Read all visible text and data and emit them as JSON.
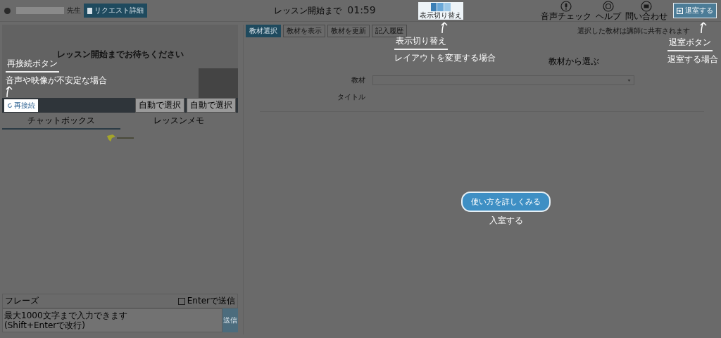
{
  "header": {
    "teacher_suffix": "先生",
    "request_button": "リクエスト詳細",
    "countdown_label": "レッスン開始まで",
    "countdown": "01:59",
    "layout_switch_label": "表示切り替え",
    "tools": [
      {
        "kind": "mic",
        "label": "音声チェック"
      },
      {
        "kind": "help",
        "label": "ヘルプ"
      },
      {
        "kind": "mail",
        "label": "問い合わせ"
      }
    ],
    "exit_button": "退室する"
  },
  "video": {
    "message": "レッスン開始までお待ちください",
    "reconnect_button": "再接続",
    "device_selects": [
      "自動で選択",
      "自動で選択"
    ]
  },
  "chat": {
    "tabs": [
      {
        "label": "チャットボックス",
        "selected": true
      },
      {
        "label": "レッスンメモ",
        "selected": false
      }
    ],
    "phrase_label": "フレーズ",
    "enter_to_send": {
      "label": "Enterで送信",
      "checked": false
    },
    "message_placeholder": "最大1000文字まで入力できます\n(Shift+Enterで改行)",
    "send_button": "送信"
  },
  "materials": {
    "toolbar": [
      {
        "label": "教材選択",
        "selected": true
      },
      {
        "label": "教材を表示",
        "selected": false
      },
      {
        "label": "教材を更新",
        "selected": false
      },
      {
        "label": "記入履歴",
        "selected": false
      }
    ],
    "note": "選択した教材は講師に共有されます",
    "heading": "教材から選ぶ",
    "fields": [
      {
        "kind": "select",
        "label": "教材"
      },
      {
        "kind": "text",
        "label": "タイトル"
      }
    ]
  },
  "tour": {
    "callouts": [
      {
        "kind": "reconnect",
        "title": "再接続ボタン",
        "text": "音声や映像が不安定な場合"
      },
      {
        "kind": "layout",
        "title": "表示切り替え",
        "text": "レイアウトを変更する場合"
      },
      {
        "kind": "exit",
        "title": "退室ボタン",
        "text": "退室する場合"
      }
    ],
    "guide_button": "使い方を詳しくみる",
    "enter_label": "入室する"
  }
}
